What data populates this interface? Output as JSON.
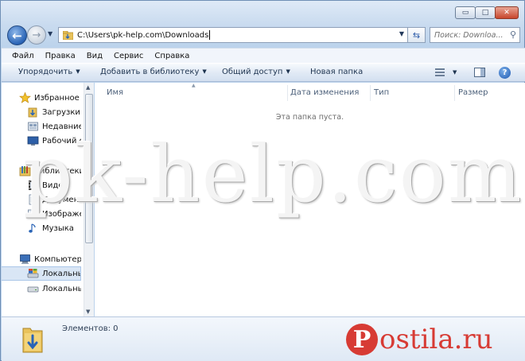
{
  "window": {
    "controls": {
      "minimize": "▭",
      "maximize": "□",
      "close": "✕"
    }
  },
  "address_bar": {
    "path": "C:\\Users\\pk-help.com\\Downloads",
    "dropdown_icon": "chevron-down-icon"
  },
  "search": {
    "placeholder": "Поиск: Downloa..."
  },
  "menu": {
    "items": [
      "Файл",
      "Правка",
      "Вид",
      "Сервис",
      "Справка"
    ]
  },
  "toolbar": {
    "organize": "Упорядочить",
    "add_to_library": "Добавить в библиотеку",
    "share": "Общий доступ",
    "new_folder": "Новая папка"
  },
  "nav_pane": {
    "favorites": "Избранное",
    "favorites_items": [
      "Загрузки",
      "Недавние",
      "Рабочий с"
    ],
    "libraries": "Библиотеки",
    "library_items": [
      "Видео",
      "Документ",
      "Изображе",
      "Музыка"
    ],
    "computer": "Компьютер",
    "computer_items": [
      "Локальны",
      "Локальны"
    ]
  },
  "columns": {
    "name": "Имя",
    "date": "Дата изменения",
    "type": "Тип",
    "size": "Размер"
  },
  "content": {
    "empty_message": "Эта папка пуста."
  },
  "details": {
    "items_count": "Элементов: 0"
  },
  "watermarks": {
    "main": "pk-help.com",
    "postila_letter": "P",
    "postila_text": "ostila.ru"
  },
  "colors": {
    "accent": "#2a64b6",
    "postila_red": "#d73b34"
  }
}
